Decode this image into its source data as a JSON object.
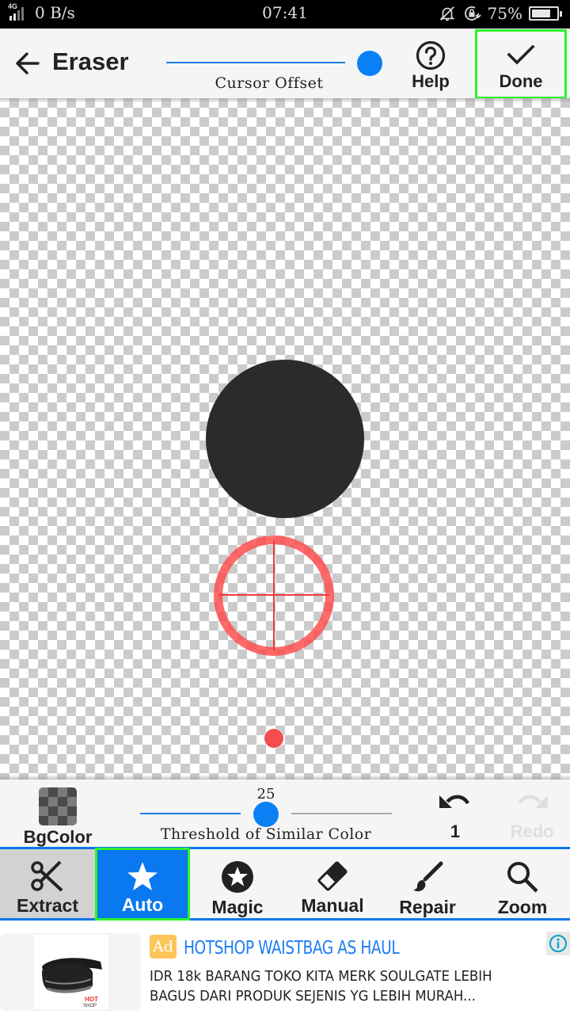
{
  "status_bar": {
    "network_type": "4G",
    "data_speed": "0 B/s",
    "time": "07:41",
    "battery_percent": "75%",
    "battery_level": 0.75,
    "icons": [
      "signal-icon",
      "mute-bell-icon",
      "rotation-lock-icon",
      "battery-icon"
    ]
  },
  "toolbar": {
    "back_icon": "arrow-left-icon",
    "title": "Eraser",
    "cursor_offset": {
      "label": "Cursor Offset",
      "value": 1.0
    },
    "help": {
      "icon": "help-circle-icon",
      "label": "Help"
    },
    "done": {
      "icon": "check-icon",
      "label": "Done"
    }
  },
  "canvas": {
    "background": "transparency-checkerboard",
    "shape_color": "#2b2b2b",
    "cursor_color": "#ff4646"
  },
  "options_bar": {
    "bgcolor": {
      "icon": "checkerboard-swatch-icon",
      "label": "BgColor"
    },
    "threshold": {
      "label": "Threshold of Similar Color",
      "value": "25",
      "fraction": 0.5
    },
    "undo": {
      "icon": "undo-icon",
      "count": "1"
    },
    "redo": {
      "icon": "redo-icon",
      "label": "Redo",
      "enabled": false
    }
  },
  "tabs": [
    {
      "id": "extract",
      "label": "Extract",
      "icon": "scissors-icon"
    },
    {
      "id": "auto",
      "label": "Auto",
      "icon": "star-icon",
      "active": true
    },
    {
      "id": "magic",
      "label": "Magic",
      "icon": "star-circle-icon"
    },
    {
      "id": "manual",
      "label": "Manual",
      "icon": "eraser-icon"
    },
    {
      "id": "repair",
      "label": "Repair",
      "icon": "brush-icon"
    },
    {
      "id": "zoom",
      "label": "Zoom",
      "icon": "magnifier-icon"
    }
  ],
  "ad": {
    "badge": "Ad",
    "title": "HOTSHOP WAISTBAG AS HAUL",
    "body": "IDR 18k BARANG TOKO KITA MERK SOULGATE LEBIH BAGUS DARI PRODUK SEJENIS YG LEBIH MURAH...",
    "image": "waist-bag-product-image",
    "brand_logo": "HOT SHOP",
    "info_icon": "info-icon"
  },
  "colors": {
    "accent": "#0a80f5",
    "highlight": "#2cf22c",
    "ad_badge": "#fdc55a",
    "ad_title": "#1c7ef0"
  }
}
